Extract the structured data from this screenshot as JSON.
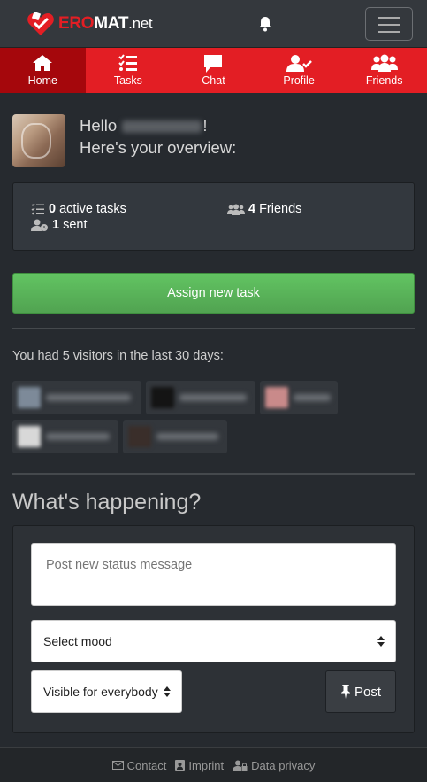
{
  "brand": {
    "part1": "ERO",
    "part2": "MAT",
    "part3": ".net",
    "accent": "#e31e24"
  },
  "nav": [
    {
      "label": "Home",
      "icon": "home-icon",
      "active": true
    },
    {
      "label": "Tasks",
      "icon": "tasks-icon",
      "active": false
    },
    {
      "label": "Chat",
      "icon": "chat-icon",
      "active": false
    },
    {
      "label": "Profile",
      "icon": "profile-icon",
      "active": false
    },
    {
      "label": "Friends",
      "icon": "friends-icon",
      "active": false
    }
  ],
  "greeting": {
    "hello": "Hello",
    "exclaim": "!",
    "overview": "Here's your overview:"
  },
  "stats": {
    "active_tasks_count": "0",
    "active_tasks_label": "active tasks",
    "friends_count": "4",
    "friends_label": "Friends",
    "sent_count": "1",
    "sent_label": "sent"
  },
  "assign_button": "Assign new task",
  "visitors_text": "You had 5 visitors in the last 30 days:",
  "whats_happening": "What's happening?",
  "status_placeholder": "Post new status message",
  "mood_select": "Select mood",
  "visibility_select": "Visible for everybody",
  "post_button": "Post",
  "footer": {
    "contact": "Contact",
    "imprint": "Imprint",
    "privacy": "Data privacy"
  }
}
